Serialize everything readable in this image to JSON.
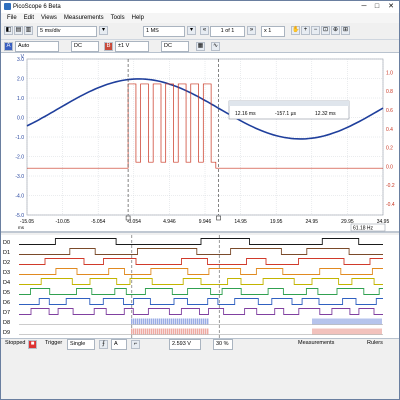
{
  "window": {
    "title": "PicoScope 6 Beta",
    "minimize": "─",
    "maximize": "□",
    "close": "✕"
  },
  "menu": [
    "File",
    "Edit",
    "Views",
    "Measurements",
    "Tools",
    "Help"
  ],
  "toolbar": {
    "timebase": "5 ms/div",
    "samples": "1 MS",
    "page": "1 of 1",
    "zoom": "x 1",
    "logo": "pico"
  },
  "channels": {
    "a_range": "Auto",
    "a_coupling": "DC",
    "b_range": "±1 V",
    "b_coupling": "DC"
  },
  "scope": {
    "left_axis_unit": "V",
    "left_ticks": [
      "3.0",
      "2.0",
      "1.0",
      "0.0",
      "-1.0",
      "-2.0",
      "-3.0",
      "-4.0",
      "-5.0"
    ],
    "right_ticks": [
      "1.0",
      "0.8",
      "0.6",
      "0.4",
      "0.2",
      "0.0",
      "-0.2",
      "-0.4"
    ],
    "time_ticks": [
      "-15.05",
      "-10.05",
      "-5.054",
      "-0.054",
      "4.946",
      "9.946",
      "14.95",
      "19.95",
      "24.95",
      "29.95",
      "34.95"
    ],
    "time_unit": "ms",
    "freq_readout": "61.18 Hz",
    "ruler_readout": {
      "t1": "12.16 ms",
      "dt": "-157.1 μs",
      "t2": "12.32 ms"
    },
    "colors": {
      "channel_a": "#1f3f9c",
      "channel_b": "#c8321e",
      "grid": "#c9ced6"
    }
  },
  "digital": {
    "labels": [
      "D0",
      "D1",
      "D2",
      "D3",
      "D4",
      "D5",
      "D6",
      "D7",
      "D8",
      "D9"
    ],
    "colors": [
      "#1a1a1a",
      "#7a4a2a",
      "#d03a2a",
      "#e08a20",
      "#c2b400",
      "#30a050",
      "#3060c0",
      "#8040a0",
      "#7a7a7a",
      "#7aa0e0"
    ]
  },
  "status": {
    "state": "Stopped",
    "trigger_label": "Trigger",
    "trigger_mode": "Single",
    "trigger_channel": "A",
    "trigger_level": "2.593 V",
    "pre_trigger": "30 %",
    "measurements_label": "Measurements",
    "rulers_label": "Rulers"
  }
}
